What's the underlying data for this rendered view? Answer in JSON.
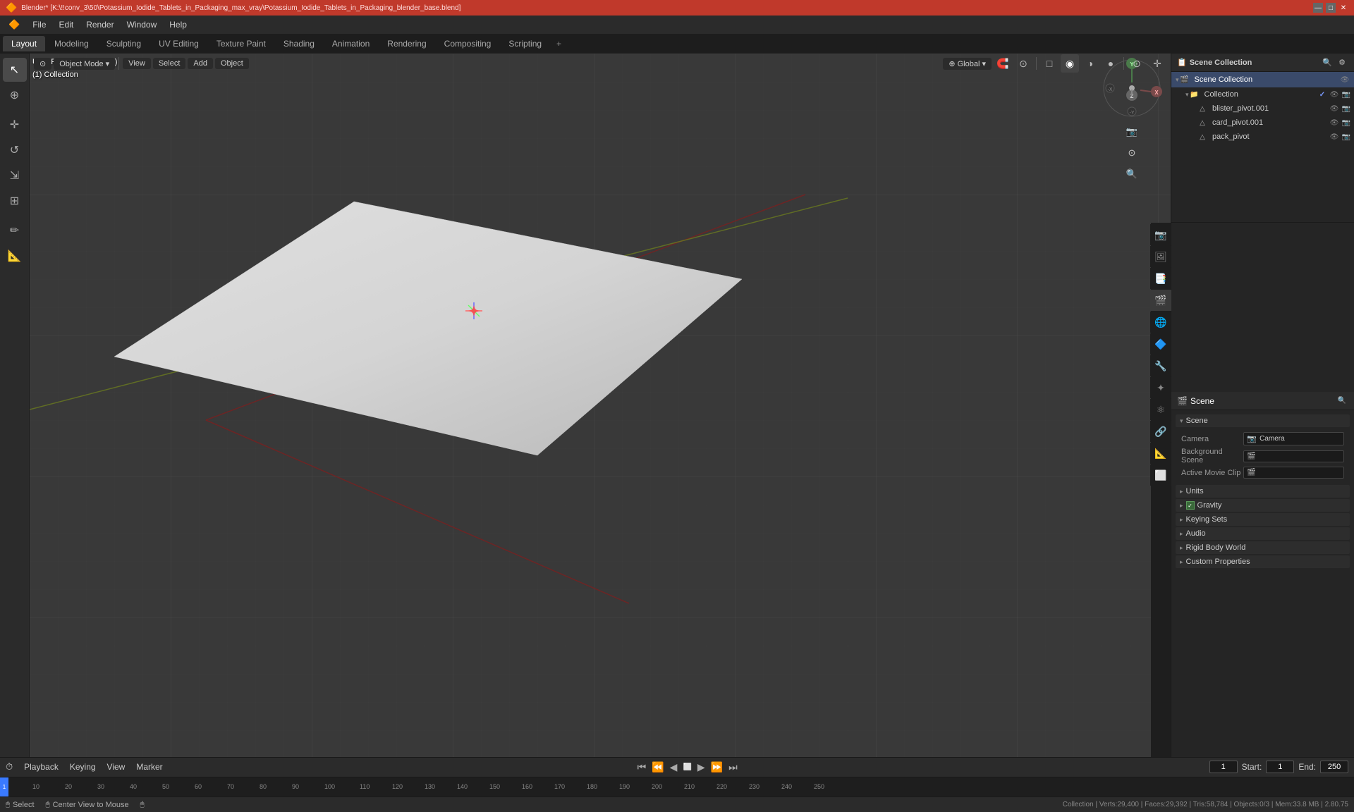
{
  "title_bar": {
    "title": "Blender* [K:\\!!conv_3\\50\\Potassium_Iodide_Tablets_in_Packaging_max_vray\\Potassium_Iodide_Tablets_in_Packaging_blender_base.blend]",
    "minimize": "—",
    "maximize": "□",
    "close": "✕"
  },
  "menu": {
    "items": [
      "Blender",
      "File",
      "Edit",
      "Render",
      "Window",
      "Help"
    ]
  },
  "tabs": {
    "items": [
      {
        "label": "Layout",
        "active": true
      },
      {
        "label": "Modeling",
        "active": false
      },
      {
        "label": "Sculpting",
        "active": false
      },
      {
        "label": "UV Editing",
        "active": false
      },
      {
        "label": "Texture Paint",
        "active": false
      },
      {
        "label": "Shading",
        "active": false
      },
      {
        "label": "Animation",
        "active": false
      },
      {
        "label": "Rendering",
        "active": false
      },
      {
        "label": "Compositing",
        "active": false
      },
      {
        "label": "Scripting",
        "active": false
      }
    ],
    "add_label": "+"
  },
  "left_tools": [
    {
      "icon": "↖",
      "label": "select-tool",
      "active": true
    },
    {
      "icon": "⊕",
      "label": "cursor-tool",
      "active": false
    },
    {
      "icon": "✛",
      "label": "move-tool",
      "active": false
    },
    {
      "icon": "↺",
      "label": "rotate-tool",
      "active": false
    },
    {
      "icon": "⇲",
      "label": "scale-tool",
      "active": false
    },
    {
      "icon": "⊞",
      "label": "transform-tool",
      "active": false
    },
    {
      "icon": "✏",
      "label": "annotate-tool",
      "active": false
    },
    {
      "icon": "✂",
      "label": "measure-tool",
      "active": false
    }
  ],
  "viewport": {
    "header_info": {
      "perspective": "User Perspective (Local)",
      "collection": "(1) Collection"
    },
    "toolbar_buttons": [
      {
        "label": "Object Mode",
        "dropdown": true
      },
      {
        "label": "Global",
        "dropdown": true
      },
      {
        "label": "↗",
        "icon": true
      },
      {
        "label": "⊙",
        "icon": true
      }
    ]
  },
  "outliner": {
    "header": {
      "title": "Scene Collection",
      "icons": [
        "🔍",
        "⚙",
        "≡"
      ]
    },
    "items": [
      {
        "label": "Collection",
        "icon": "📁",
        "level": 0,
        "expanded": true,
        "has_eye": true,
        "has_camera": true
      },
      {
        "label": "blister_pivot.001",
        "icon": "△",
        "level": 1,
        "has_eye": true,
        "has_camera": true
      },
      {
        "label": "card_pivot.001",
        "icon": "△",
        "level": 1,
        "has_eye": true,
        "has_camera": true
      },
      {
        "label": "pack_pivot",
        "icon": "△",
        "level": 1,
        "has_eye": true,
        "has_camera": true
      }
    ]
  },
  "properties": {
    "header": {
      "title": "Scene",
      "icon": "🎬"
    },
    "scene_section": {
      "label": "Scene",
      "subsections": [
        {
          "label": "Camera",
          "value": "",
          "has_icon": true
        },
        {
          "label": "Background Scene",
          "value": "",
          "has_icon": true
        },
        {
          "label": "Active Movie Clip",
          "value": "",
          "has_icon": true
        }
      ]
    },
    "sections": [
      {
        "label": "Units",
        "expanded": false
      },
      {
        "label": "Gravity",
        "expanded": false,
        "has_checkbox": true,
        "checked": true
      },
      {
        "label": "Keying Sets",
        "expanded": false
      },
      {
        "label": "Audio",
        "expanded": false
      },
      {
        "label": "Rigid Body World",
        "expanded": false
      },
      {
        "label": "Custom Properties",
        "expanded": false
      }
    ]
  },
  "timeline": {
    "playback_label": "Playback",
    "keying_label": "Keying",
    "view_label": "View",
    "marker_label": "Marker",
    "current_frame": "1",
    "start_frame": "1",
    "end_frame": "250",
    "start_label": "Start:",
    "end_label": "End:",
    "frame_markers": [
      "1",
      "10",
      "20",
      "30",
      "40",
      "50",
      "60",
      "70",
      "80",
      "90",
      "100",
      "110",
      "120",
      "130",
      "140",
      "150",
      "160",
      "170",
      "180",
      "190",
      "200",
      "210",
      "220",
      "230",
      "240",
      "250"
    ]
  },
  "status_bar": {
    "select_label": "Select",
    "center_label": "Center View to Mouse",
    "info": "Collection | Verts:29,400 | Faces:29,392 | Tris:58,784 | Objects:0/3 | Mem:33.8 MB | 2.80.75"
  }
}
